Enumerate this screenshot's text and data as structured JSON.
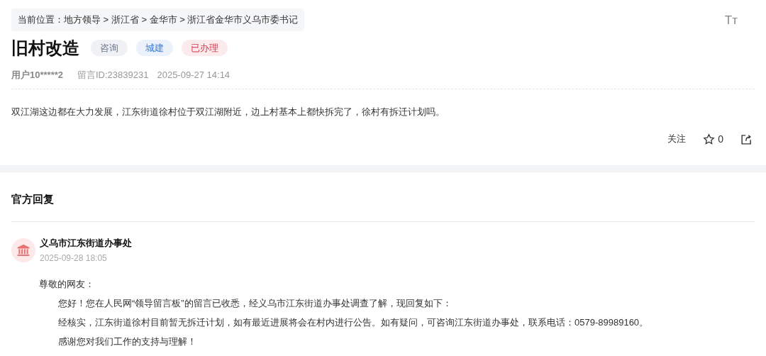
{
  "breadcrumb": "当前位置：地方领导 > 浙江省 > 金华市 > 浙江省金华市义乌市委书记",
  "font_size_button": "Tт",
  "title": "旧村改造",
  "tags": [
    {
      "label": "咨询",
      "color": "#6b7a90"
    },
    {
      "label": "城建",
      "color": "#3a7bd5"
    },
    {
      "label": "已办理",
      "color": "#d9364a"
    }
  ],
  "meta": {
    "user": "用户10*****2",
    "message_id": "留言ID:23839231",
    "time": "2025-09-27 14:14"
  },
  "content": "双江湖这边都在大力发展，江东街道徐村位于双江湖附近，边上村基本上都快拆完了，徐村有拆迁计划吗。",
  "actions": {
    "follow": "关注",
    "star_count": "0"
  },
  "reply_section": {
    "heading": "官方回复",
    "department": "义乌市江东街道办事处",
    "time": "2025-09-28 18:05",
    "greeting": "尊敬的网友：",
    "paragraphs": [
      "您好！您在人民网“领导留言板”的留言已收悉，经义乌市江东街道办事处调查了解，现回复如下：",
      "经核实，江东街道徐村目前暂无拆迁计划，如有最近进展将会在村内进行公告。如有疑问，可咨询江东街道办事处，联系电话：0579-89989160。",
      "感谢您对我们工作的支持与理解！"
    ]
  }
}
